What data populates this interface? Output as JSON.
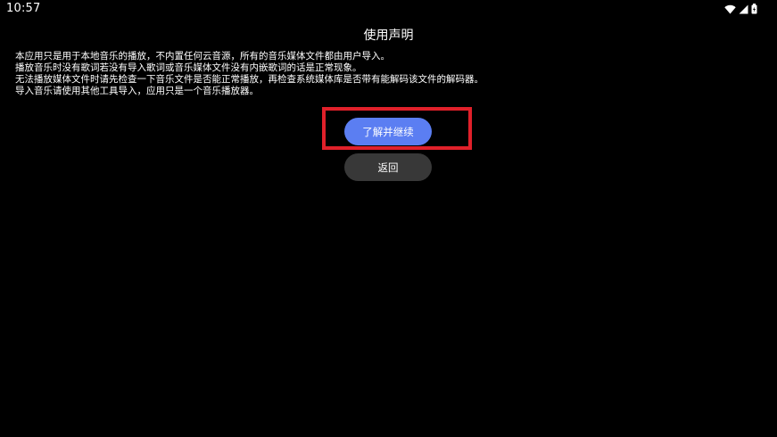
{
  "status_bar": {
    "time": "10:57",
    "icons": [
      "wifi-icon",
      "cellular-signal-icon",
      "battery-icon"
    ]
  },
  "dialog": {
    "title": "使用声明",
    "lines": [
      "本应用只是用于本地音乐的播放，不内置任何云音源，所有的音乐媒体文件都由用户导入。",
      "播放音乐时没有歌词若没有导入歌词或音乐媒体文件没有内嵌歌词的话是正常现象。",
      "无法播放媒体文件时请先检查一下音乐文件是否能正常播放，再检查系统媒体库是否带有能解码该文件的解码器。",
      "导入音乐请使用其他工具导入，应用只是一个音乐播放器。"
    ],
    "accept_label": "了解并继续",
    "back_label": "返回"
  },
  "colors": {
    "background": "#000000",
    "primary_button": "#5b7ef2",
    "secondary_button": "#383838",
    "highlight": "#e0202a"
  }
}
